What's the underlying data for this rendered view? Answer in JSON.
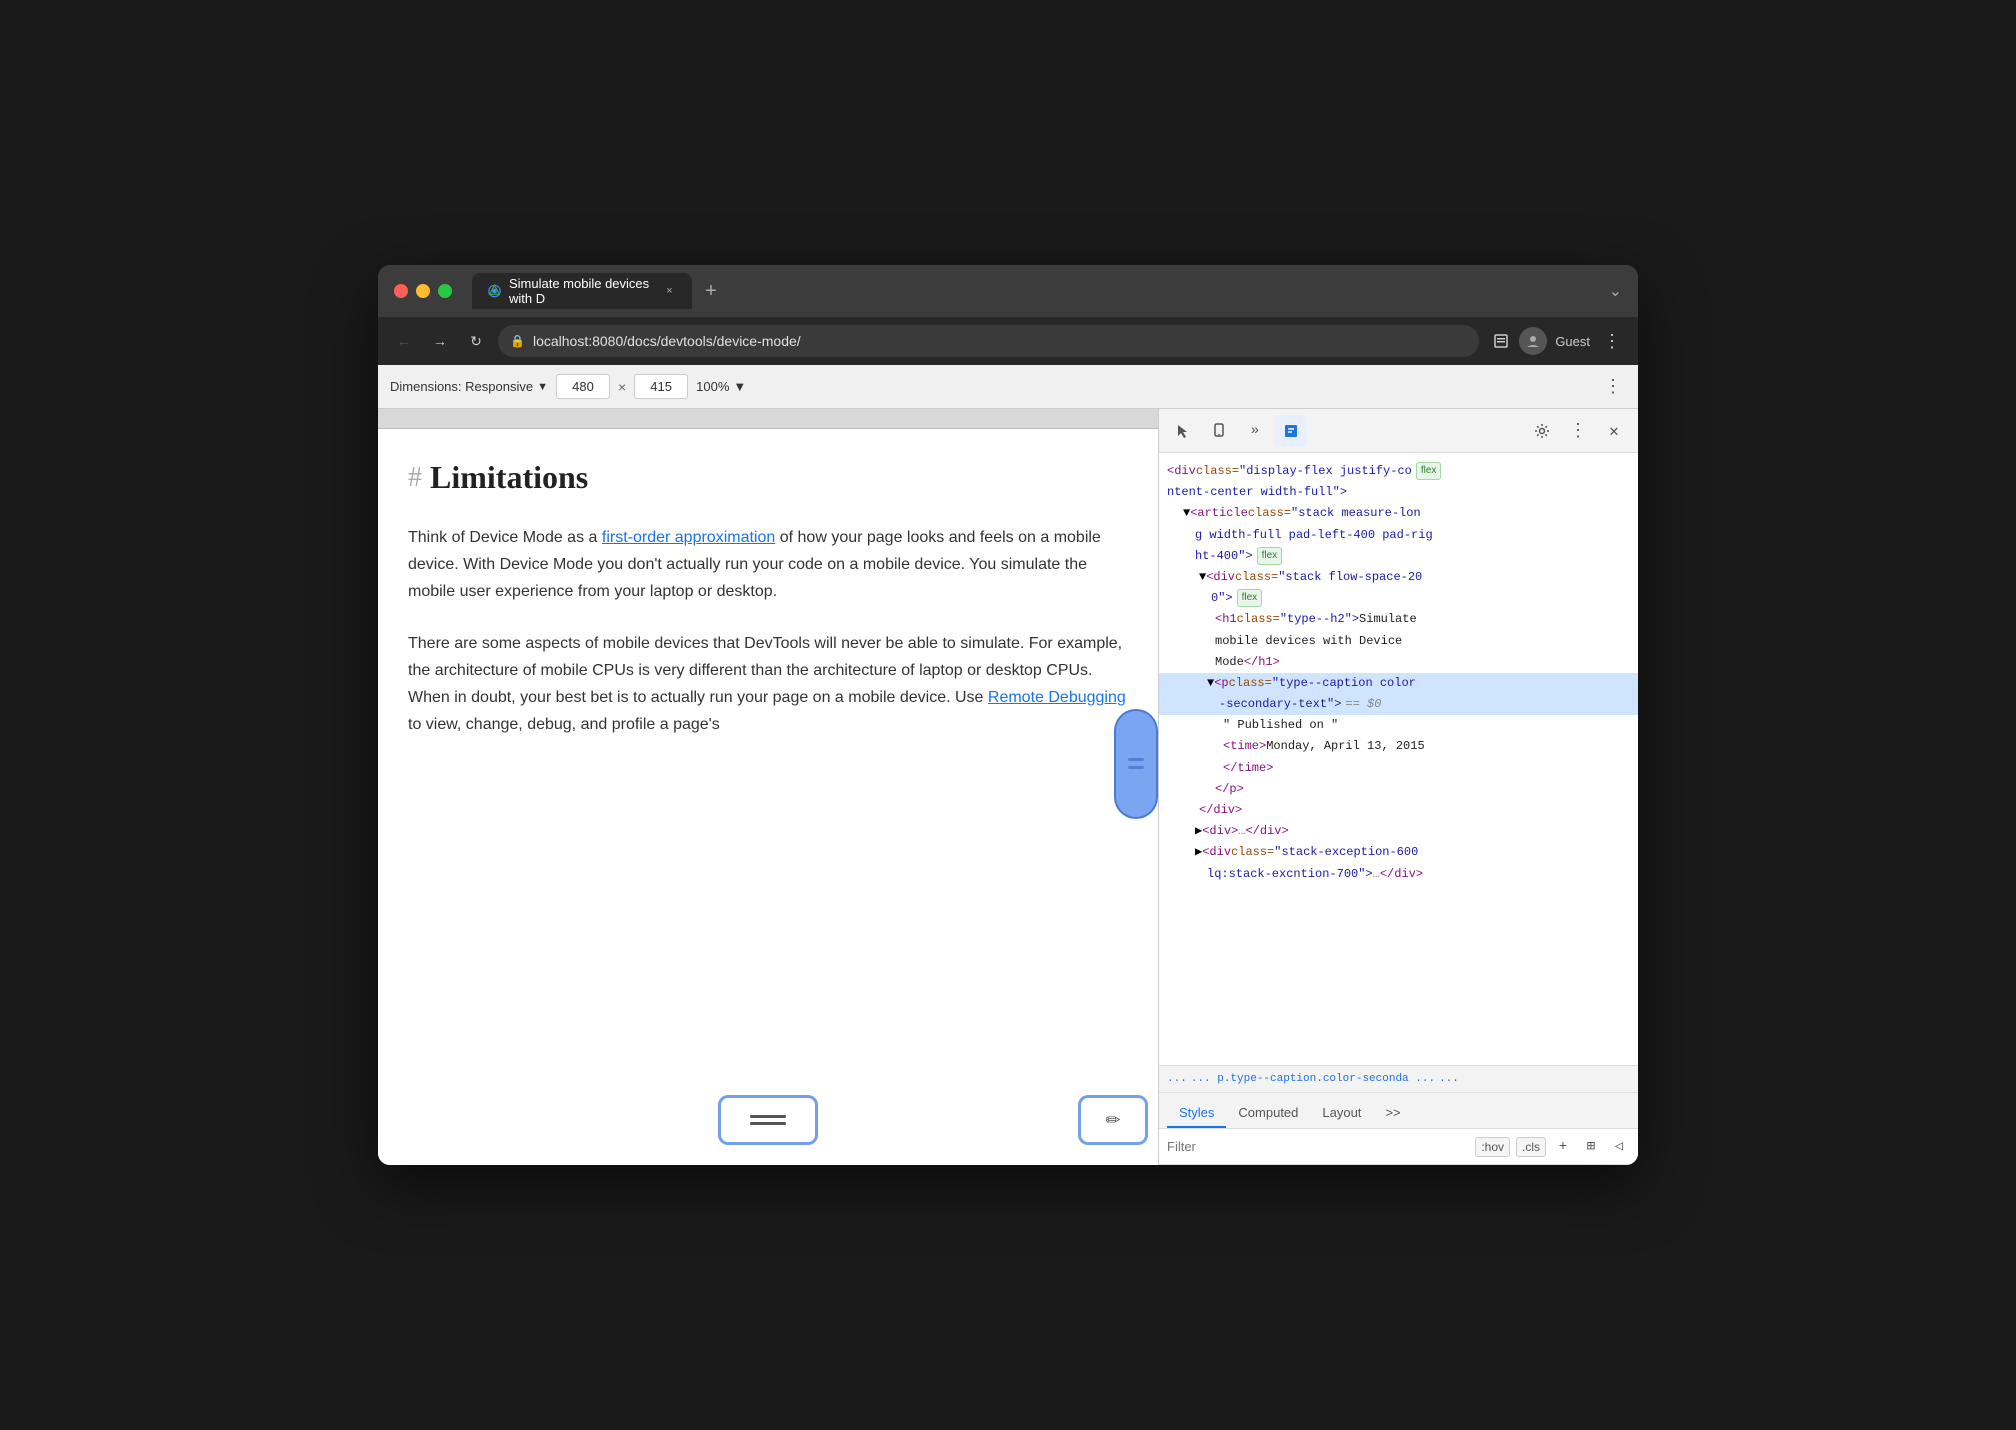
{
  "browser": {
    "tab_title": "Simulate mobile devices with D",
    "tab_close_label": "×",
    "tab_new_label": "+",
    "url": "localhost:8080/docs/devtools/device-mode/",
    "nav_back": "←",
    "nav_forward": "→",
    "nav_refresh": "↻",
    "address_lock": "🔒",
    "profile_label": "Guest",
    "more_menu": "⋮",
    "tab_bar_more": "⌄"
  },
  "device_toolbar": {
    "dimensions_label": "Dimensions: Responsive",
    "width_value": "480",
    "height_value": "415",
    "separator": "×",
    "zoom_label": "100%",
    "zoom_arrow": "▼",
    "more_icon": "⋮"
  },
  "page": {
    "heading_hash": "#",
    "heading": "Limitations",
    "paragraph1": "Think of Device Mode as a first-order approximation of how your page looks and feels on a mobile device. With Device Mode you don't actually run your code on a mobile device. You simulate the mobile user experience from your laptop or desktop.",
    "paragraph1_link": "first-order approximation",
    "paragraph2": "There are some aspects of mobile devices that DevTools will never be able to simulate. For example, the architecture of mobile CPUs is very different than the architecture of laptop or desktop CPUs. When in doubt, your best bet is to actually run your page on a mobile device. Use Remote Debugging to view, change, debug, and profile a page's",
    "paragraph2_link1": "Remote",
    "paragraph2_link2": "Debugging"
  },
  "devtools": {
    "toolbar_buttons": [
      "cursor",
      "device",
      "more",
      "chat",
      "gear",
      "more_vert",
      "close"
    ],
    "html_lines": [
      {
        "indent": 0,
        "content": "<div class=\"display-flex justify-co",
        "has_badge": true,
        "badge": "flex",
        "continued": "ntent-center width-full\">"
      },
      {
        "indent": 1,
        "content": "<article class=\"stack measure-lon",
        "continued": "g width-full pad-left-400 pad-rig",
        "has_badge": true,
        "badge": "flex"
      },
      {
        "indent": 1,
        "content": "ht-400\">",
        "has_badge": false
      },
      {
        "indent": 2,
        "content": "<div class=\"stack flow-space-20",
        "continued": "0\">",
        "has_badge": true,
        "badge": "flex"
      },
      {
        "indent": 3,
        "content": "<h1 class=\"type--h2\">Simulate",
        "has_badge": false
      },
      {
        "indent": 3,
        "content": "mobile devices with Device",
        "has_badge": false
      },
      {
        "indent": 3,
        "content": "Mode</h1>",
        "has_badge": false
      },
      {
        "indent": 3,
        "selected": true,
        "content": "<p class=\"type--caption color",
        "has_badge": false
      },
      {
        "indent": 3,
        "selected": true,
        "content": "-secondary-text\">",
        "has_badge": false,
        "dollar": "== $0"
      },
      {
        "indent": 4,
        "content": "\" Published on \"",
        "has_badge": false
      },
      {
        "indent": 4,
        "content": "<time>Monday, April 13, 2015",
        "has_badge": false
      },
      {
        "indent": 4,
        "content": "</time>",
        "has_badge": false
      },
      {
        "indent": 3,
        "content": "</p>",
        "has_badge": false
      },
      {
        "indent": 2,
        "content": "</div>",
        "has_badge": false
      },
      {
        "indent": 1,
        "content": "<div>…</div>",
        "has_badge": false
      },
      {
        "indent": 1,
        "content": "<div class=\"stack-exception-600",
        "has_badge": false
      },
      {
        "indent": 1,
        "content": "lq:stack-excntion-700\">…</div>",
        "has_badge": false
      }
    ],
    "breadcrumb": "...   p.type--caption.color-seconda   ...",
    "tabs": [
      "Styles",
      "Computed",
      "Layout",
      ">>"
    ],
    "active_tab": "Styles",
    "filter_placeholder": "Filter",
    "filter_btn1": ":hov",
    "filter_btn2": ".cls",
    "filter_btn3": "+",
    "filter_btn4": "⊞",
    "filter_btn5": "◁"
  }
}
